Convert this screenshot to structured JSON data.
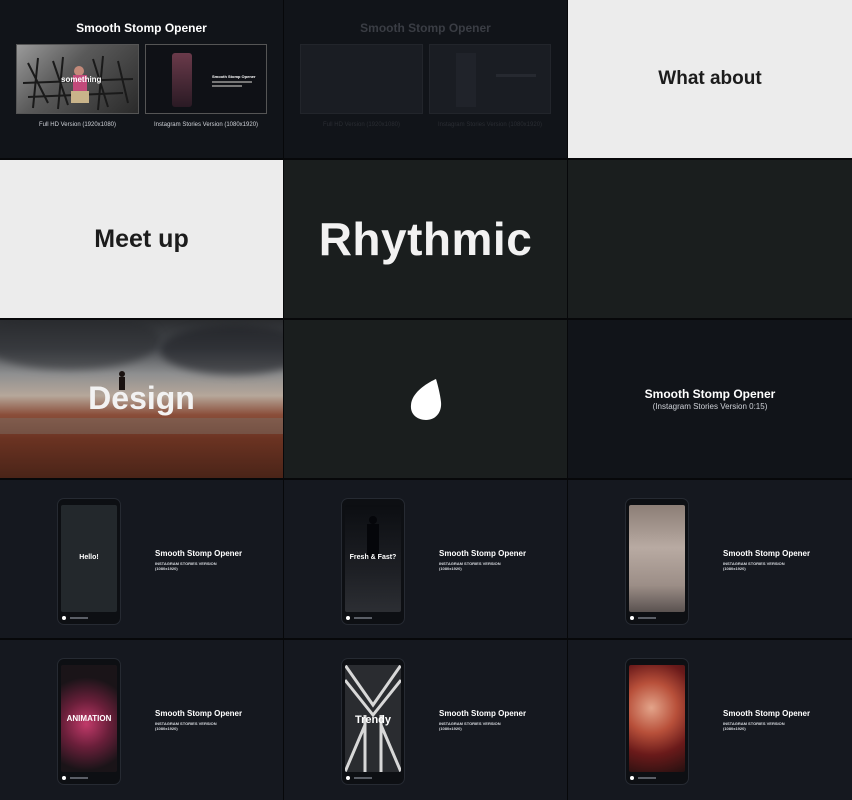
{
  "product_title": "Smooth Stomp Opener",
  "cell1": {
    "overlay_word": "something",
    "thumb_b_title": "Smooth Stomp Opener",
    "caption_a": "Full HD Version (1920x1080)",
    "caption_b": "Instagram Stories Version (1080x1920)"
  },
  "words": {
    "what_about": "What about",
    "meet_up": "Meet up",
    "rhythmic": "Rhythmic",
    "design": "Design"
  },
  "end_card": {
    "title": "Smooth Stomp Opener",
    "subtitle": "(Instagram Stories Version 0:15)"
  },
  "stories": [
    {
      "phone_text": "Hello!",
      "title": "Smooth Stomp Opener",
      "sub1": "INSTAGRAM STORIES VERSION",
      "sub2": "(1080x1920)"
    },
    {
      "phone_text": "Fresh & Fast?",
      "title": "Smooth Stomp Opener",
      "sub1": "INSTAGRAM STORIES VERSION",
      "sub2": "(1080x1920)"
    },
    {
      "phone_text": "",
      "title": "Smooth Stomp Opener",
      "sub1": "INSTAGRAM STORIES VERSION",
      "sub2": "(1080x1920)"
    },
    {
      "phone_text": "ANIMATION",
      "title": "Smooth Stomp Opener",
      "sub1": "INSTAGRAM STORIES VERSION",
      "sub2": "(1080x1920)"
    },
    {
      "phone_text": "Trendy",
      "title": "Smooth Stomp Opener",
      "sub1": "INSTAGRAM STORIES VERSION",
      "sub2": "(1080x1920)"
    },
    {
      "phone_text": "",
      "title": "Smooth Stomp Opener",
      "sub1": "INSTAGRAM STORIES VERSION",
      "sub2": "(1080x1920)"
    }
  ],
  "colors": {
    "light_bg": "#ececec",
    "dark_bg": "#111419",
    "charcoal_bg": "#1a1e1e",
    "text_dark": "#1c1c1c",
    "text_light": "#ffffff"
  },
  "icons": {
    "logo": "envato-leaf-icon"
  }
}
